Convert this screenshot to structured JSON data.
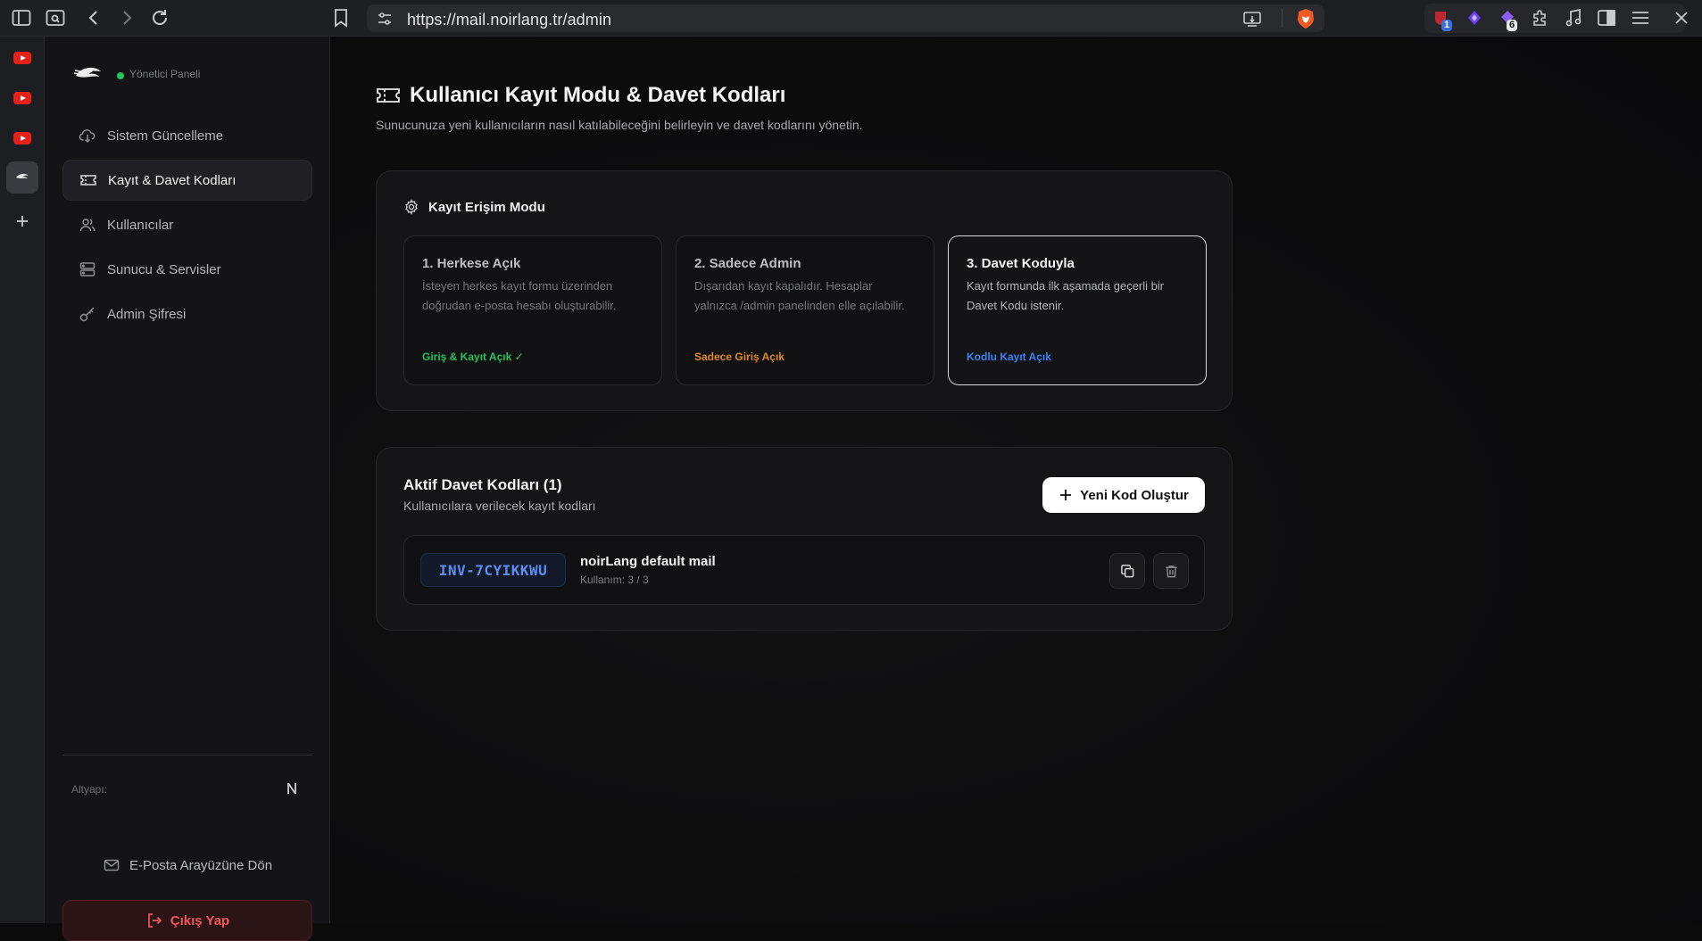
{
  "browser": {
    "url": "https://mail.noirlang.tr/admin",
    "extension_badges": [
      "1",
      "6"
    ]
  },
  "sidebar": {
    "status_label": "Yönetici Paneli",
    "items": [
      {
        "label": "Sistem Güncelleme",
        "icon": "cloud-download-icon"
      },
      {
        "label": "Kayıt & Davet Kodları",
        "icon": "ticket-icon",
        "active": true
      },
      {
        "label": "Kullanıcılar",
        "icon": "users-icon"
      },
      {
        "label": "Sunucu & Servisler",
        "icon": "server-icon"
      },
      {
        "label": "Admin Şifresi",
        "icon": "key-icon"
      }
    ],
    "infra_label": "Altyapı:",
    "back_label": "E-Posta Arayüzüne Dön",
    "logout_label": "Çıkış Yap"
  },
  "main": {
    "title": "Kullanıcı Kayıt Modu & Davet Kodları",
    "description": "Sunucunuza yeni kullanıcıların nasıl katılabileceğini belirleyin ve davet kodlarını yönetin.",
    "mode_section": {
      "title": "Kayıt Erişim Modu",
      "cards": [
        {
          "title": "1. Herkese Açık",
          "desc": "İsteyen herkes kayıt formu üzerinden doğrudan e-posta hesabı oluşturabilir.",
          "status": "Giriş & Kayıt Açık ✓",
          "status_color": "#22c55e",
          "selected": false
        },
        {
          "title": "2. Sadece Admin",
          "desc": "Dışarıdan kayıt kapalıdır. Hesaplar yalnızca /admin panelinden elle açılabilir.",
          "status": "Sadece Giriş Açık",
          "status_color": "#e08a1e",
          "selected": false
        },
        {
          "title": "3. Davet Koduyla",
          "desc": "Kayıt formunda ilk aşamada geçerli bir Davet Kodu istenir.",
          "status": "Kodlu Kayıt Açık",
          "status_color": "#3b82f6",
          "selected": true
        }
      ]
    },
    "codes_section": {
      "title": "Aktif Davet Kodları (1)",
      "subtitle": "Kullanıcılara verilecek kayıt kodları",
      "new_button_label": "Yeni Kod Oluştur",
      "codes": [
        {
          "code": "INV-7CYIKKWU",
          "name": "noirLang default mail",
          "usage": "Kullanım: 3 / 3"
        }
      ]
    }
  }
}
